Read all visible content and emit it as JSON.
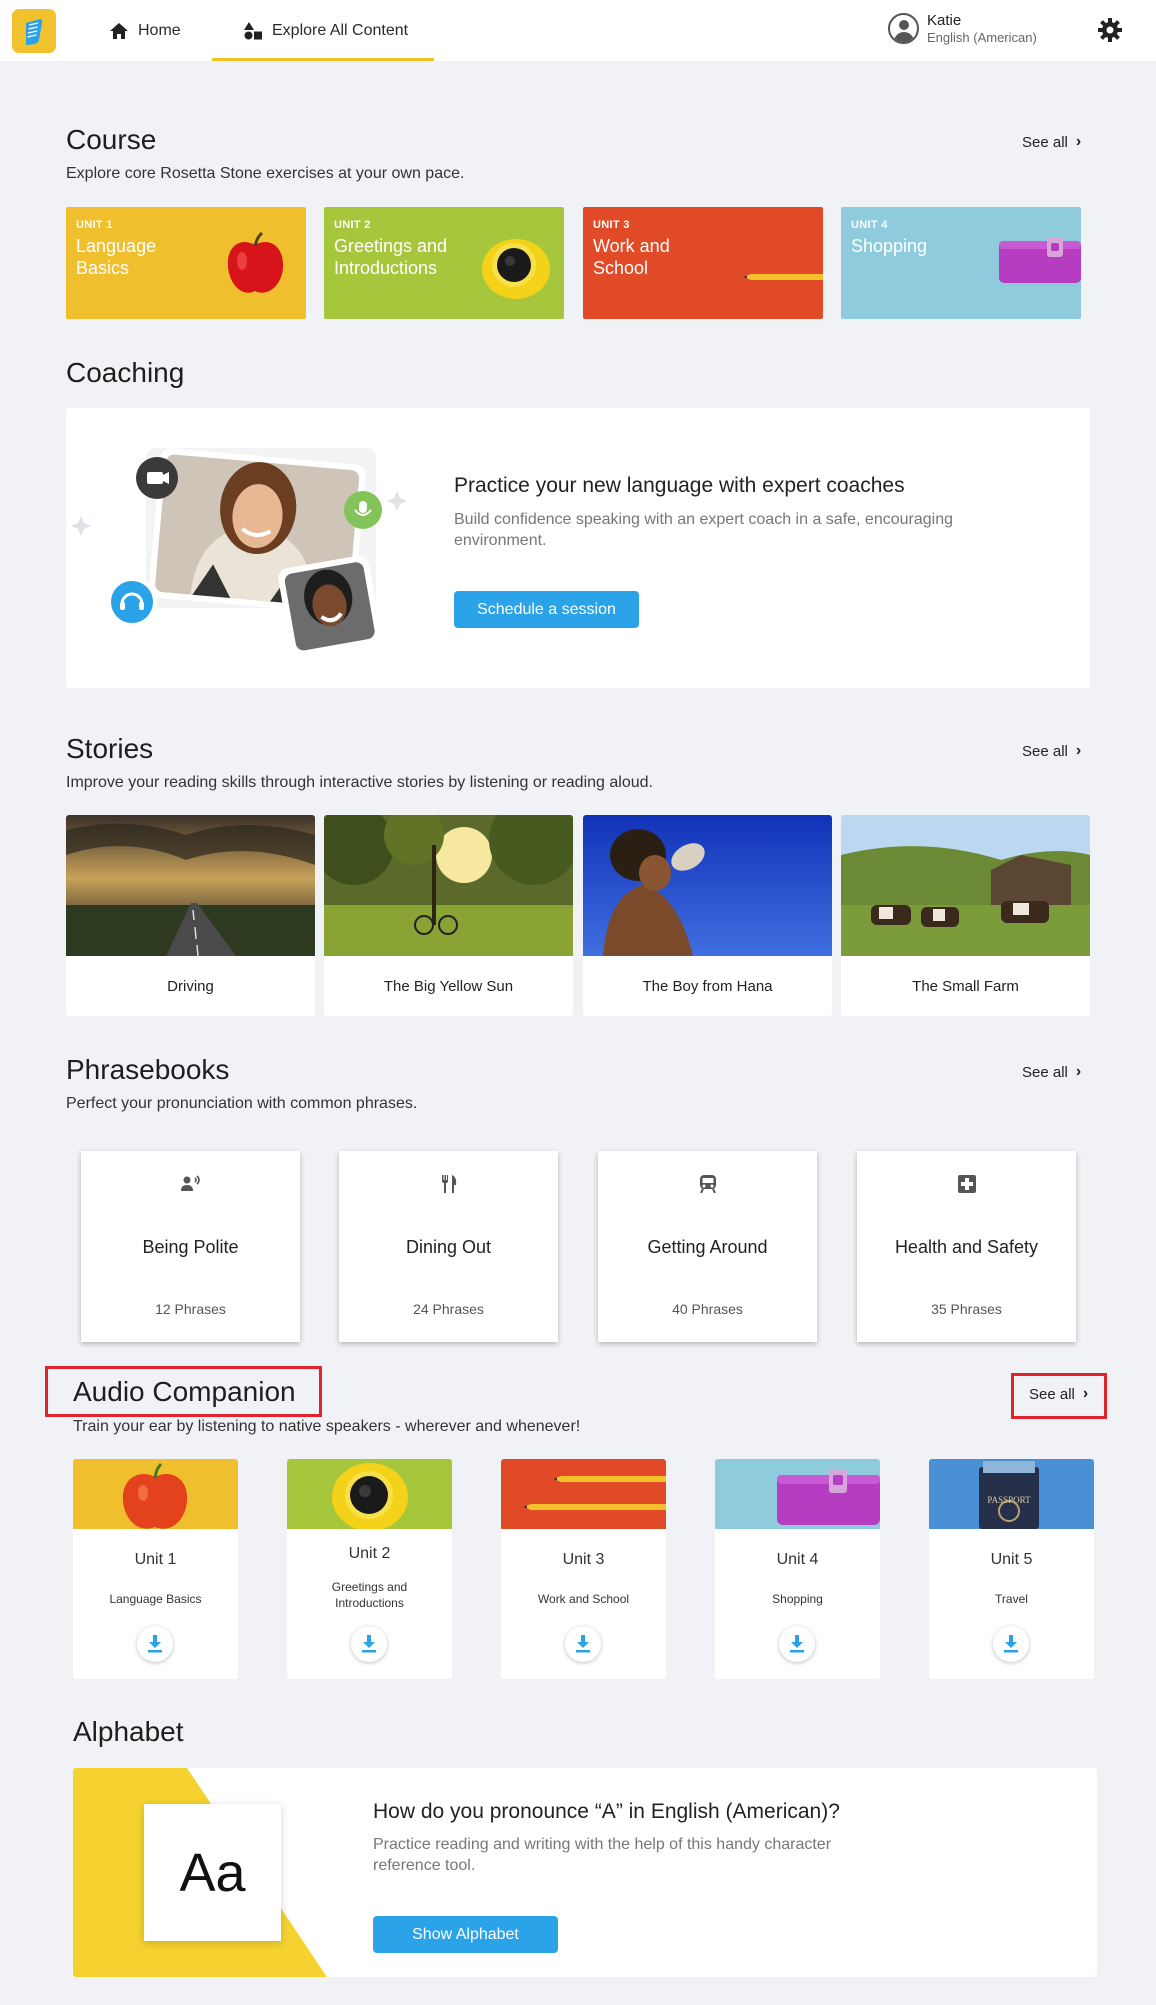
{
  "nav": {
    "home_label": "Home",
    "explore_label": "Explore All Content",
    "user_name": "Katie",
    "user_language": "English (American)"
  },
  "course": {
    "title": "Course",
    "subtitle": "Explore core Rosetta Stone exercises at your own pace.",
    "see_all": "See all",
    "units": [
      {
        "num": "UNIT 1",
        "name": "Language Basics",
        "color": "#f0bf2e"
      },
      {
        "num": "UNIT 2",
        "name": "Greetings and Introductions",
        "color": "#a6c63c"
      },
      {
        "num": "UNIT 3",
        "name": "Work and School",
        "color": "#e14a27"
      },
      {
        "num": "UNIT 4",
        "name": "Shopping",
        "color": "#8ecbdc"
      }
    ]
  },
  "coaching": {
    "title": "Coaching",
    "card_title": "Practice your new language with expert coaches",
    "card_desc": "Build confidence speaking with an expert coach in a safe, encouraging environment.",
    "button": "Schedule a session"
  },
  "stories": {
    "title": "Stories",
    "subtitle": "Improve your reading skills through interactive stories by listening or reading aloud.",
    "see_all": "See all",
    "items": [
      "Driving",
      "The Big Yellow Sun",
      "The Boy from Hana",
      "The Small Farm"
    ]
  },
  "phrasebooks": {
    "title": "Phrasebooks",
    "subtitle": "Perfect your pronunciation with common phrases.",
    "see_all": "See all",
    "items": [
      {
        "title": "Being Polite",
        "count": "12 Phrases",
        "icon": "speaking-person-icon"
      },
      {
        "title": "Dining Out",
        "count": "24 Phrases",
        "icon": "fork-knife-icon"
      },
      {
        "title": "Getting Around",
        "count": "40 Phrases",
        "icon": "train-icon"
      },
      {
        "title": "Health and Safety",
        "count": "35 Phrases",
        "icon": "medical-cross-icon"
      }
    ]
  },
  "audio": {
    "title": "Audio Companion",
    "subtitle": "Train your ear by listening to native speakers - wherever and whenever!",
    "see_all": "See all",
    "items": [
      {
        "unit": "Unit 1",
        "name": "Language Basics"
      },
      {
        "unit": "Unit 2",
        "name": "Greetings and Introductions"
      },
      {
        "unit": "Unit 3",
        "name": "Work and School"
      },
      {
        "unit": "Unit 4",
        "name": "Shopping"
      },
      {
        "unit": "Unit 5",
        "name": "Travel"
      }
    ],
    "passport_text": "PASSPORT"
  },
  "alphabet": {
    "title": "Alphabet",
    "sample": "Aa",
    "card_title": "How do you pronounce “A” in English (American)?",
    "card_desc": "Practice reading and writing with the help of this handy character reference tool.",
    "button": "Show Alphabet"
  },
  "colors": {
    "accent_yellow": "#f3c21f",
    "button_blue": "#2aa3e9",
    "highlight_red": "#e0242e"
  }
}
